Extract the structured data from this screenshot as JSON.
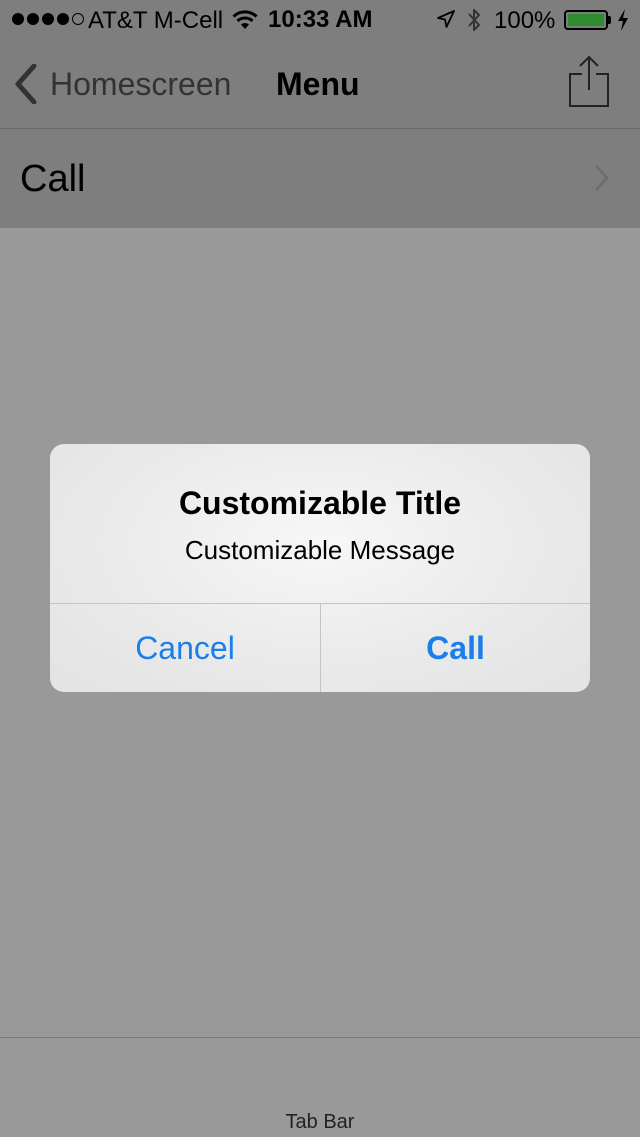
{
  "status_bar": {
    "carrier": "AT&T M-Cell",
    "time": "10:33 AM",
    "battery_percent": "100%",
    "signal_bars_filled": 4,
    "signal_bars_total": 5
  },
  "nav_bar": {
    "back_label": "Homescreen",
    "title": "Menu"
  },
  "list": {
    "items": [
      {
        "label": "Call"
      }
    ]
  },
  "alert": {
    "title": "Customizable Title",
    "message": "Customizable Message",
    "cancel_label": "Cancel",
    "confirm_label": "Call",
    "button_color": "#1a7fe8"
  },
  "tab_bar": {
    "label": "Tab Bar"
  },
  "icons": [
    "wifi-icon",
    "location-arrow-icon",
    "bluetooth-icon",
    "battery-icon",
    "charging-bolt-icon",
    "back-chevron-icon",
    "share-icon",
    "chevron-right-icon"
  ]
}
